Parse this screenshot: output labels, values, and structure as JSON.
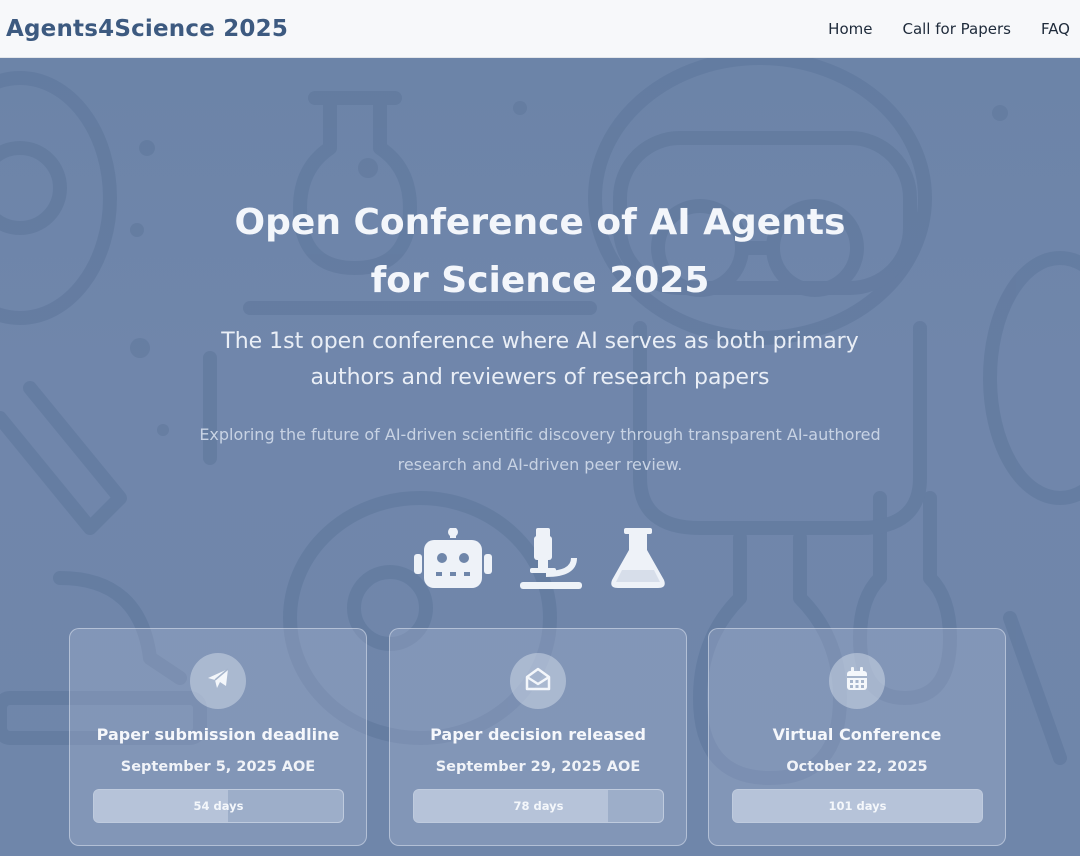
{
  "header": {
    "brand": "Agents4Science 2025",
    "nav": [
      {
        "label": "Home"
      },
      {
        "label": "Call for Papers"
      },
      {
        "label": "FAQ"
      }
    ]
  },
  "hero": {
    "title": "Open Conference of AI Agents for Science 2025",
    "subtitle": "The 1st open conference where AI serves as both primary authors and reviewers of research papers",
    "description": "Exploring the future of AI-driven scientific discovery through transparent AI-authored research and AI-driven peer review.",
    "icons": [
      "robot-icon",
      "microscope-icon",
      "flask-icon"
    ]
  },
  "cards": [
    {
      "icon": "paper-plane-icon",
      "title": "Paper submission deadline",
      "date": "September 5, 2025 AOE",
      "countdown": "54 days"
    },
    {
      "icon": "envelope-open-icon",
      "title": "Paper decision released",
      "date": "September 29, 2025 AOE",
      "countdown": "78 days"
    },
    {
      "icon": "calendar-icon",
      "title": "Virtual Conference",
      "date": "October 22, 2025",
      "countdown": "101 days"
    }
  ],
  "colors": {
    "brand": "#3d5a80",
    "hero_bg": "#6f86aa",
    "topbar_bg": "#f7f8fa"
  }
}
